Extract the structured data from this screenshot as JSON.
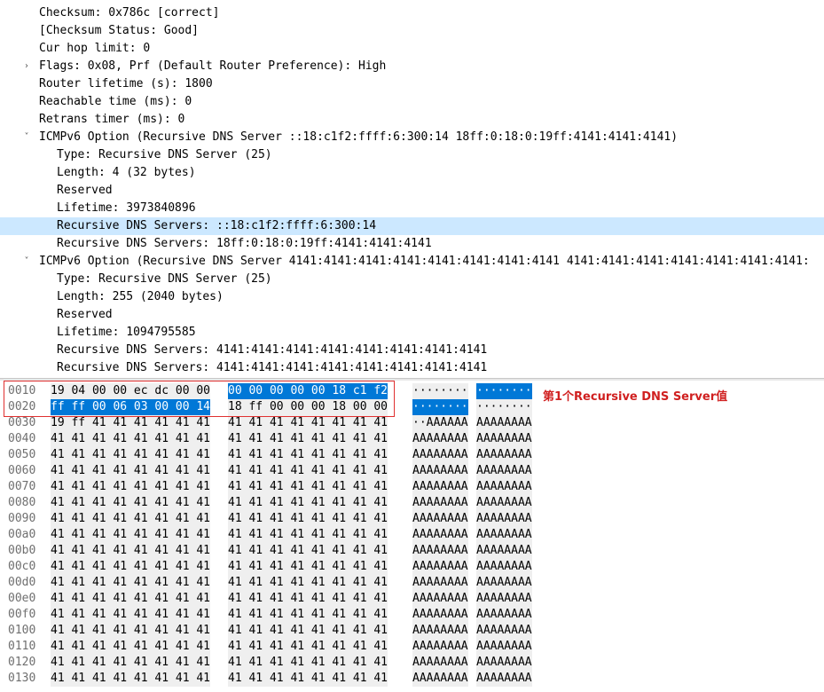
{
  "tree": {
    "rows": [
      {
        "text": "Checksum: 0x786c [correct]",
        "arrow": ""
      },
      {
        "text": "[Checksum Status: Good]",
        "arrow": ""
      },
      {
        "text": "Cur hop limit: 0",
        "arrow": ""
      },
      {
        "text": "Flags: 0x08, Prf (Default Router Preference): High",
        "arrow": "collapsed"
      },
      {
        "text": "Router lifetime (s): 1800",
        "arrow": ""
      },
      {
        "text": "Reachable time (ms): 0",
        "arrow": ""
      },
      {
        "text": "Retrans timer (ms): 0",
        "arrow": ""
      },
      {
        "text": "ICMPv6 Option (Recursive DNS Server ::18:c1f2:ffff:6:300:14 18ff:0:18:0:19ff:4141:4141:4141)",
        "arrow": "expanded"
      },
      {
        "text": "Type: Recursive DNS Server (25)",
        "arrow": ""
      },
      {
        "text": "Length: 4 (32 bytes)",
        "arrow": ""
      },
      {
        "text": "Reserved",
        "arrow": ""
      },
      {
        "text": "Lifetime: 3973840896",
        "arrow": ""
      },
      {
        "text": "Recursive DNS Servers: ::18:c1f2:ffff:6:300:14",
        "arrow": "",
        "selected": true
      },
      {
        "text": "Recursive DNS Servers: 18ff:0:18:0:19ff:4141:4141:4141",
        "arrow": ""
      },
      {
        "text": "ICMPv6 Option (Recursive DNS Server 4141:4141:4141:4141:4141:4141:4141:4141 4141:4141:4141:4141:4141:4141:4141:",
        "arrow": "expanded"
      },
      {
        "text": "Type: Recursive DNS Server (25)",
        "arrow": ""
      },
      {
        "text": "Length: 255 (2040 bytes)",
        "arrow": ""
      },
      {
        "text": "Reserved",
        "arrow": ""
      },
      {
        "text": "Lifetime: 1094795585",
        "arrow": ""
      },
      {
        "text": "Recursive DNS Servers: 4141:4141:4141:4141:4141:4141:4141:4141",
        "arrow": ""
      },
      {
        "text": "Recursive DNS Servers: 4141:4141:4141:4141:4141:4141:4141:4141",
        "arrow": ""
      }
    ]
  },
  "hex": {
    "rows": [
      {
        "offset": "0010",
        "b1": "19 04 00 00 ec dc 00 00",
        "b2": "00 00 00 00 00 18 c1 f2",
        "a1": "········",
        "a2": "········"
      },
      {
        "offset": "0020",
        "b1": "ff ff 00 06 03 00 00 14",
        "b2": "18 ff 00 00 00 18 00 00",
        "a1": "········",
        "a2": "········"
      },
      {
        "offset": "0030",
        "b1": "19 ff 41 41 41 41 41 41",
        "b2": "41 41 41 41 41 41 41 41",
        "a1": "··AAAAAA",
        "a2": "AAAAAAAA"
      },
      {
        "offset": "0040",
        "b1": "41 41 41 41 41 41 41 41",
        "b2": "41 41 41 41 41 41 41 41",
        "a1": "AAAAAAAA",
        "a2": "AAAAAAAA"
      },
      {
        "offset": "0050",
        "b1": "41 41 41 41 41 41 41 41",
        "b2": "41 41 41 41 41 41 41 41",
        "a1": "AAAAAAAA",
        "a2": "AAAAAAAA"
      },
      {
        "offset": "0060",
        "b1": "41 41 41 41 41 41 41 41",
        "b2": "41 41 41 41 41 41 41 41",
        "a1": "AAAAAAAA",
        "a2": "AAAAAAAA"
      },
      {
        "offset": "0070",
        "b1": "41 41 41 41 41 41 41 41",
        "b2": "41 41 41 41 41 41 41 41",
        "a1": "AAAAAAAA",
        "a2": "AAAAAAAA"
      },
      {
        "offset": "0080",
        "b1": "41 41 41 41 41 41 41 41",
        "b2": "41 41 41 41 41 41 41 41",
        "a1": "AAAAAAAA",
        "a2": "AAAAAAAA"
      },
      {
        "offset": "0090",
        "b1": "41 41 41 41 41 41 41 41",
        "b2": "41 41 41 41 41 41 41 41",
        "a1": "AAAAAAAA",
        "a2": "AAAAAAAA"
      },
      {
        "offset": "00a0",
        "b1": "41 41 41 41 41 41 41 41",
        "b2": "41 41 41 41 41 41 41 41",
        "a1": "AAAAAAAA",
        "a2": "AAAAAAAA"
      },
      {
        "offset": "00b0",
        "b1": "41 41 41 41 41 41 41 41",
        "b2": "41 41 41 41 41 41 41 41",
        "a1": "AAAAAAAA",
        "a2": "AAAAAAAA"
      },
      {
        "offset": "00c0",
        "b1": "41 41 41 41 41 41 41 41",
        "b2": "41 41 41 41 41 41 41 41",
        "a1": "AAAAAAAA",
        "a2": "AAAAAAAA"
      },
      {
        "offset": "00d0",
        "b1": "41 41 41 41 41 41 41 41",
        "b2": "41 41 41 41 41 41 41 41",
        "a1": "AAAAAAAA",
        "a2": "AAAAAAAA"
      },
      {
        "offset": "00e0",
        "b1": "41 41 41 41 41 41 41 41",
        "b2": "41 41 41 41 41 41 41 41",
        "a1": "AAAAAAAA",
        "a2": "AAAAAAAA"
      },
      {
        "offset": "00f0",
        "b1": "41 41 41 41 41 41 41 41",
        "b2": "41 41 41 41 41 41 41 41",
        "a1": "AAAAAAAA",
        "a2": "AAAAAAAA"
      },
      {
        "offset": "0100",
        "b1": "41 41 41 41 41 41 41 41",
        "b2": "41 41 41 41 41 41 41 41",
        "a1": "AAAAAAAA",
        "a2": "AAAAAAAA"
      },
      {
        "offset": "0110",
        "b1": "41 41 41 41 41 41 41 41",
        "b2": "41 41 41 41 41 41 41 41",
        "a1": "AAAAAAAA",
        "a2": "AAAAAAAA"
      },
      {
        "offset": "0120",
        "b1": "41 41 41 41 41 41 41 41",
        "b2": "41 41 41 41 41 41 41 41",
        "a1": "AAAAAAAA",
        "a2": "AAAAAAAA"
      },
      {
        "offset": "0130",
        "b1": "41 41 41 41 41 41 41 41",
        "b2": "41 41 41 41 41 41 41 41",
        "a1": "AAAAAAAA",
        "a2": "AAAAAAAA"
      }
    ]
  },
  "annotation": {
    "label": "第1个Recursive DNS Server值",
    "color": "#d02020"
  },
  "colors": {
    "selection_row": "#cce8ff",
    "hex_highlight": "#0078d7",
    "hex_bg": "#efefef"
  },
  "icons": {
    "expanded": "chevron-down-icon",
    "collapsed": "chevron-right-icon"
  }
}
